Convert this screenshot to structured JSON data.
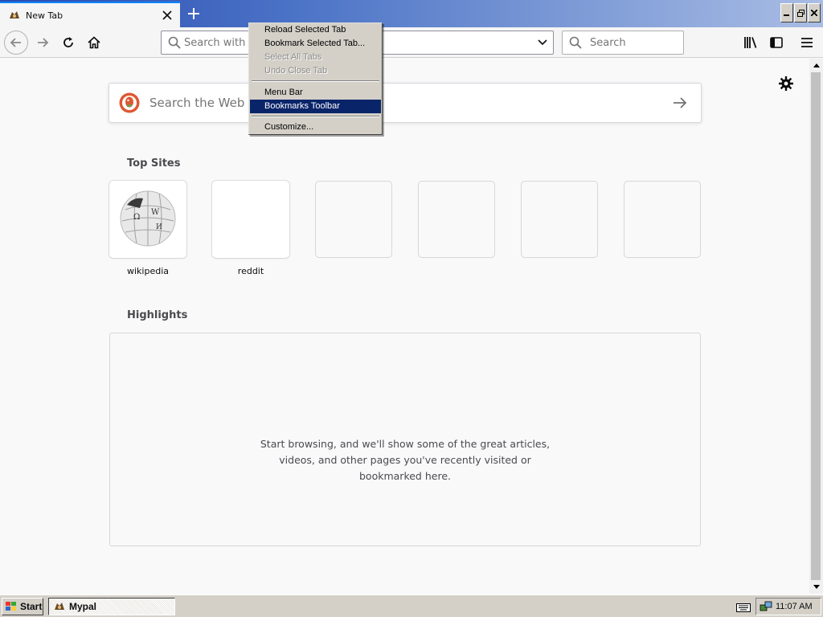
{
  "browser": {
    "tab": {
      "title": "New Tab",
      "icons": {
        "favicon": "mypal-icon",
        "close": "close-icon"
      }
    },
    "new_tab_icon": "plus-icon",
    "window_controls": [
      "minimize-icon",
      "restore-icon",
      "close-icon"
    ],
    "nav": {
      "back_icon": "back-arrow-icon",
      "forward_icon": "forward-arrow-icon",
      "reload_icon": "reload-icon",
      "home_icon": "home-icon",
      "url_placeholder": "Search with D",
      "dropdown_icon": "chevron-down-icon",
      "search_placeholder": "Search",
      "library_icon": "library-icon",
      "sidebar_icon": "sidebar-icon",
      "menu_icon": "hamburger-menu-icon"
    }
  },
  "context_menu": {
    "items": [
      {
        "label": "Reload Selected Tab",
        "state": "normal"
      },
      {
        "label": "Bookmark Selected Tab...",
        "state": "normal"
      },
      {
        "label": "Select All Tabs",
        "state": "disabled"
      },
      {
        "label": "Undo Close Tab",
        "state": "disabled"
      },
      {
        "label": "Menu Bar",
        "state": "normal"
      },
      {
        "label": "Bookmarks Toolbar",
        "state": "selected"
      },
      {
        "label": "Customize...",
        "state": "normal"
      }
    ],
    "selected_color": "#0a246a"
  },
  "newtab": {
    "settings_icon": "gear-icon",
    "search": {
      "placeholder": "Search the Web",
      "engine_icon": "duckduckgo-icon",
      "go_icon": "arrow-right-icon"
    },
    "top_sites": {
      "title": "Top Sites",
      "tiles": [
        {
          "label": "wikipedia",
          "icon": "wikipedia-globe-icon"
        },
        {
          "label": "reddit",
          "icon": ""
        },
        {
          "label": ""
        },
        {
          "label": ""
        },
        {
          "label": ""
        },
        {
          "label": ""
        }
      ]
    },
    "highlights": {
      "title": "Highlights",
      "empty_line1": "Start browsing, and we'll show some of the great articles,",
      "empty_line2": "videos, and other pages you've recently visited or",
      "empty_line3": "bookmarked here."
    }
  },
  "taskbar": {
    "start_label": "Start",
    "task_label": "Mypal",
    "clock": "11:07 AM",
    "tray_icons": [
      "keyboard-icon",
      "network-icon"
    ]
  },
  "colors": {
    "accent": "#0a84ff",
    "titlebar": "#2a4bb0",
    "page_bg": "#f9f9fa"
  }
}
